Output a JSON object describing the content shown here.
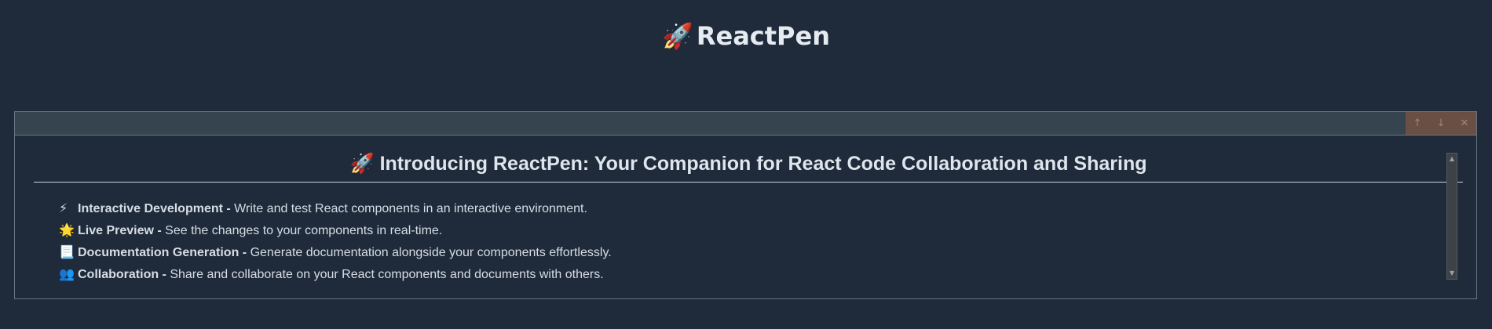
{
  "app": {
    "title_emoji": "🚀",
    "title": "ReactPen"
  },
  "panel": {
    "controls": [
      {
        "icon": "arrow-up-icon",
        "glyph": "↑"
      },
      {
        "icon": "arrow-down-icon",
        "glyph": "↓"
      },
      {
        "icon": "close-icon",
        "glyph": "✕"
      }
    ],
    "heading": "🚀 Introducing ReactPen: Your Companion for React Code Collaboration and Sharing",
    "features": [
      {
        "icon": "⚡",
        "name": "Interactive Development -",
        "desc": " Write and test React components in an interactive environment."
      },
      {
        "icon": "🌟",
        "name": "Live Preview -",
        "desc": " See the changes to your components in real-time."
      },
      {
        "icon": "📃",
        "name": "Documentation Generation -",
        "desc": " Generate documentation alongside your components effortlessly."
      },
      {
        "icon": "👥",
        "name": "Collaboration -",
        "desc": " Share and collaborate on your React components and documents with others."
      }
    ],
    "scrollbar": {
      "up_glyph": "▲",
      "down_glyph": "▼"
    }
  },
  "colors": {
    "background": "#1f2b3a",
    "toolbar": "#364450",
    "controls_bg": "#6a4f45"
  }
}
